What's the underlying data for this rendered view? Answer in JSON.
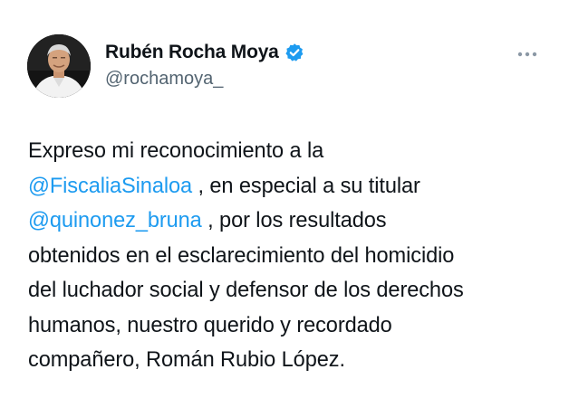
{
  "author": {
    "display_name": "Rubén Rocha Moya",
    "handle": "@rochamoya_",
    "verified_badge_color": "#1d9bf0"
  },
  "menu": {
    "icon": "more-horizontal-icon"
  },
  "tweet": {
    "line1_text": "Expreso mi reconocimiento a la",
    "mention1": "@FiscaliaSinaloa",
    "line2_text": " , en especial a su titular",
    "mention2": "@quinonez_bruna",
    "line3_text": " , por los resultados",
    "line4_text": "obtenidos en el esclarecimiento del homicidio",
    "line5_text": "del luchador social y defensor de los derechos",
    "line6_text": "humanos, nuestro querido y recordado",
    "line7_text": "compañero, Román Rubio López."
  },
  "colors": {
    "text": "#0f1419",
    "secondary": "#536471",
    "link": "#1d9bf0"
  }
}
